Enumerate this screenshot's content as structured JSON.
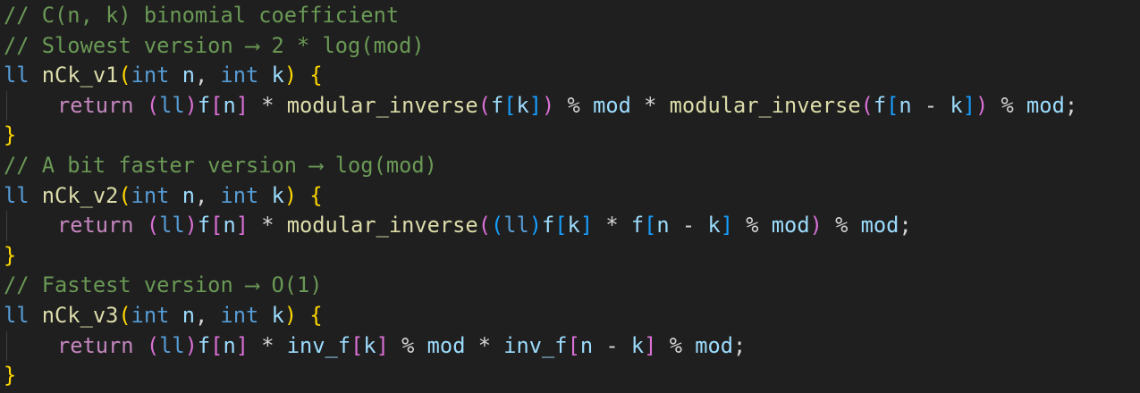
{
  "editor": {
    "theme_colors": {
      "background": "#1f1f1f",
      "comment": "#6a9955",
      "keyword": "#c586c0",
      "type": "#569cd6",
      "function": "#dcdcaa",
      "variable": "#9cdcfe",
      "text": "#d4d4d4",
      "bracket_level_1": "#ffd700",
      "bracket_level_2": "#da70d6",
      "bracket_level_3": "#179fff"
    },
    "lines": [
      {
        "indent": false,
        "tokens": [
          {
            "t": "// C(n, k) binomial coefficient",
            "c": "comment"
          }
        ]
      },
      {
        "indent": false,
        "tokens": [
          {
            "t": "// Slowest version ⟶ 2 * log(mod)",
            "c": "comment"
          }
        ]
      },
      {
        "indent": false,
        "tokens": [
          {
            "t": "ll",
            "c": "type"
          },
          {
            "t": " ",
            "c": "plain"
          },
          {
            "t": "nCk_v1",
            "c": "func"
          },
          {
            "t": "(",
            "c": "b1"
          },
          {
            "t": "int",
            "c": "type"
          },
          {
            "t": " ",
            "c": "plain"
          },
          {
            "t": "n",
            "c": "var"
          },
          {
            "t": ", ",
            "c": "plain"
          },
          {
            "t": "int",
            "c": "type"
          },
          {
            "t": " ",
            "c": "plain"
          },
          {
            "t": "k",
            "c": "var"
          },
          {
            "t": ")",
            "c": "b1"
          },
          {
            "t": " ",
            "c": "plain"
          },
          {
            "t": "{",
            "c": "b1"
          }
        ]
      },
      {
        "indent": true,
        "tokens": [
          {
            "t": "return",
            "c": "keyword"
          },
          {
            "t": " ",
            "c": "plain"
          },
          {
            "t": "(",
            "c": "b2"
          },
          {
            "t": "ll",
            "c": "type"
          },
          {
            "t": ")",
            "c": "b2"
          },
          {
            "t": "f",
            "c": "var"
          },
          {
            "t": "[",
            "c": "b2"
          },
          {
            "t": "n",
            "c": "var"
          },
          {
            "t": "]",
            "c": "b2"
          },
          {
            "t": " * ",
            "c": "plain"
          },
          {
            "t": "modular_inverse",
            "c": "func"
          },
          {
            "t": "(",
            "c": "b2"
          },
          {
            "t": "f",
            "c": "var"
          },
          {
            "t": "[",
            "c": "b3"
          },
          {
            "t": "k",
            "c": "var"
          },
          {
            "t": "]",
            "c": "b3"
          },
          {
            "t": ")",
            "c": "b2"
          },
          {
            "t": " % ",
            "c": "plain"
          },
          {
            "t": "mod",
            "c": "var"
          },
          {
            "t": " * ",
            "c": "plain"
          },
          {
            "t": "modular_inverse",
            "c": "func"
          },
          {
            "t": "(",
            "c": "b2"
          },
          {
            "t": "f",
            "c": "var"
          },
          {
            "t": "[",
            "c": "b3"
          },
          {
            "t": "n",
            "c": "var"
          },
          {
            "t": " - ",
            "c": "plain"
          },
          {
            "t": "k",
            "c": "var"
          },
          {
            "t": "]",
            "c": "b3"
          },
          {
            "t": ")",
            "c": "b2"
          },
          {
            "t": " % ",
            "c": "plain"
          },
          {
            "t": "mod",
            "c": "var"
          },
          {
            "t": ";",
            "c": "plain"
          }
        ]
      },
      {
        "indent": false,
        "tokens": [
          {
            "t": "}",
            "c": "b1"
          }
        ]
      },
      {
        "indent": false,
        "tokens": [
          {
            "t": "// A bit faster version ⟶ log(mod)",
            "c": "comment"
          }
        ]
      },
      {
        "indent": false,
        "tokens": [
          {
            "t": "ll",
            "c": "type"
          },
          {
            "t": " ",
            "c": "plain"
          },
          {
            "t": "nCk_v2",
            "c": "func"
          },
          {
            "t": "(",
            "c": "b1"
          },
          {
            "t": "int",
            "c": "type"
          },
          {
            "t": " ",
            "c": "plain"
          },
          {
            "t": "n",
            "c": "var"
          },
          {
            "t": ", ",
            "c": "plain"
          },
          {
            "t": "int",
            "c": "type"
          },
          {
            "t": " ",
            "c": "plain"
          },
          {
            "t": "k",
            "c": "var"
          },
          {
            "t": ")",
            "c": "b1"
          },
          {
            "t": " ",
            "c": "plain"
          },
          {
            "t": "{",
            "c": "b1"
          }
        ]
      },
      {
        "indent": true,
        "tokens": [
          {
            "t": "return",
            "c": "keyword"
          },
          {
            "t": " ",
            "c": "plain"
          },
          {
            "t": "(",
            "c": "b2"
          },
          {
            "t": "ll",
            "c": "type"
          },
          {
            "t": ")",
            "c": "b2"
          },
          {
            "t": "f",
            "c": "var"
          },
          {
            "t": "[",
            "c": "b2"
          },
          {
            "t": "n",
            "c": "var"
          },
          {
            "t": "]",
            "c": "b2"
          },
          {
            "t": " * ",
            "c": "plain"
          },
          {
            "t": "modular_inverse",
            "c": "func"
          },
          {
            "t": "(",
            "c": "b2"
          },
          {
            "t": "(",
            "c": "b3"
          },
          {
            "t": "ll",
            "c": "type"
          },
          {
            "t": ")",
            "c": "b3"
          },
          {
            "t": "f",
            "c": "var"
          },
          {
            "t": "[",
            "c": "b3"
          },
          {
            "t": "k",
            "c": "var"
          },
          {
            "t": "]",
            "c": "b3"
          },
          {
            "t": " * ",
            "c": "plain"
          },
          {
            "t": "f",
            "c": "var"
          },
          {
            "t": "[",
            "c": "b3"
          },
          {
            "t": "n",
            "c": "var"
          },
          {
            "t": " - ",
            "c": "plain"
          },
          {
            "t": "k",
            "c": "var"
          },
          {
            "t": "]",
            "c": "b3"
          },
          {
            "t": " % ",
            "c": "plain"
          },
          {
            "t": "mod",
            "c": "var"
          },
          {
            "t": ")",
            "c": "b2"
          },
          {
            "t": " % ",
            "c": "plain"
          },
          {
            "t": "mod",
            "c": "var"
          },
          {
            "t": ";",
            "c": "plain"
          }
        ]
      },
      {
        "indent": false,
        "tokens": [
          {
            "t": "}",
            "c": "b1"
          }
        ]
      },
      {
        "indent": false,
        "tokens": [
          {
            "t": "// Fastest version ⟶ O(1)",
            "c": "comment"
          }
        ]
      },
      {
        "indent": false,
        "tokens": [
          {
            "t": "ll",
            "c": "type"
          },
          {
            "t": " ",
            "c": "plain"
          },
          {
            "t": "nCk_v3",
            "c": "func"
          },
          {
            "t": "(",
            "c": "b1"
          },
          {
            "t": "int",
            "c": "type"
          },
          {
            "t": " ",
            "c": "plain"
          },
          {
            "t": "n",
            "c": "var"
          },
          {
            "t": ", ",
            "c": "plain"
          },
          {
            "t": "int",
            "c": "type"
          },
          {
            "t": " ",
            "c": "plain"
          },
          {
            "t": "k",
            "c": "var"
          },
          {
            "t": ")",
            "c": "b1"
          },
          {
            "t": " ",
            "c": "plain"
          },
          {
            "t": "{",
            "c": "b1"
          }
        ]
      },
      {
        "indent": true,
        "tokens": [
          {
            "t": "return",
            "c": "keyword"
          },
          {
            "t": " ",
            "c": "plain"
          },
          {
            "t": "(",
            "c": "b2"
          },
          {
            "t": "ll",
            "c": "type"
          },
          {
            "t": ")",
            "c": "b2"
          },
          {
            "t": "f",
            "c": "var"
          },
          {
            "t": "[",
            "c": "b2"
          },
          {
            "t": "n",
            "c": "var"
          },
          {
            "t": "]",
            "c": "b2"
          },
          {
            "t": " * ",
            "c": "plain"
          },
          {
            "t": "inv_f",
            "c": "var"
          },
          {
            "t": "[",
            "c": "b2"
          },
          {
            "t": "k",
            "c": "var"
          },
          {
            "t": "]",
            "c": "b2"
          },
          {
            "t": " % ",
            "c": "plain"
          },
          {
            "t": "mod",
            "c": "var"
          },
          {
            "t": " * ",
            "c": "plain"
          },
          {
            "t": "inv_f",
            "c": "var"
          },
          {
            "t": "[",
            "c": "b2"
          },
          {
            "t": "n",
            "c": "var"
          },
          {
            "t": " - ",
            "c": "plain"
          },
          {
            "t": "k",
            "c": "var"
          },
          {
            "t": "]",
            "c": "b2"
          },
          {
            "t": " % ",
            "c": "plain"
          },
          {
            "t": "mod",
            "c": "var"
          },
          {
            "t": ";",
            "c": "plain"
          }
        ]
      },
      {
        "indent": false,
        "tokens": [
          {
            "t": "}",
            "c": "b1"
          }
        ]
      }
    ]
  }
}
